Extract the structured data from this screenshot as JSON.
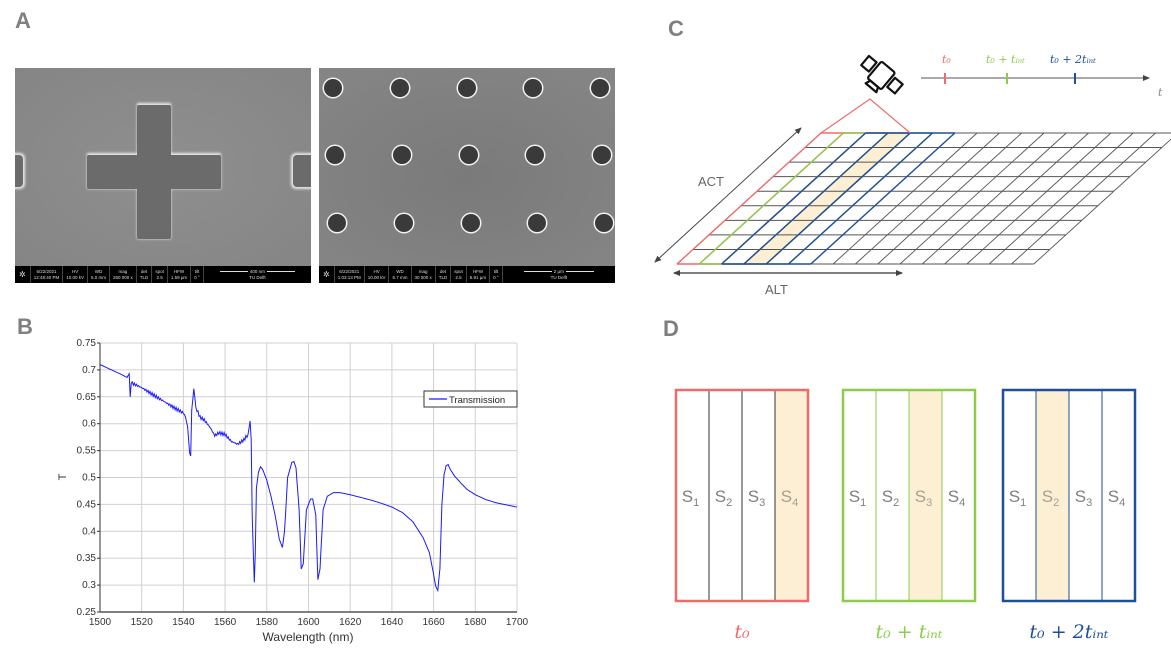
{
  "panels": {
    "a": {
      "label": "A",
      "images": [
        {
          "subject": "cross-shaped-aperture",
          "info_bar": {
            "date": "6/22/2021",
            "time": "12:48:40 PM",
            "hv_label": "HV",
            "hv": "10.00 kV",
            "wd_label": "WD",
            "wd": "5.0 mm",
            "mag_label": "mag",
            "mag": "260 000 x",
            "det_label": "det",
            "det": "TLD",
            "spot_label": "spot",
            "spot": "2.5",
            "hfw_label": "HFW",
            "hfw": "1.59 µm",
            "tilt_label": "tilt",
            "tilt": "0 °",
            "scale": "400 nm",
            "institution": "TU Delft"
          }
        },
        {
          "subject": "circular-hole-array",
          "info_bar": {
            "date": "6/22/2021",
            "time": "1:03:13 PM",
            "hv_label": "HV",
            "hv": "10.00 kV",
            "wd_label": "WD",
            "wd": "6.7 mm",
            "mag_label": "mag",
            "mag": "30 000 x",
            "det_label": "det",
            "det": "TLD",
            "spot_label": "spot",
            "spot": "2.5",
            "hfw_label": "HFW",
            "hfw": "6.91 µm",
            "tilt_label": "tilt",
            "tilt": "0 °",
            "scale": "2 µm",
            "institution": "TU Delft"
          }
        }
      ]
    },
    "b": {
      "label": "B"
    },
    "c": {
      "label": "C",
      "act_label": "ACT",
      "alt_label": "ALT",
      "time_axis_label": "t",
      "time_marks": [
        {
          "label": "t₀",
          "color": "#f06a6a"
        },
        {
          "label": "t₀ + tᵢₙₜ",
          "color": "#8ccc4a"
        },
        {
          "label": "t₀ + 2tᵢₙₜ",
          "color": "#1f4e9c"
        }
      ],
      "satellite_icon": "satellite-icon"
    },
    "d": {
      "label": "D",
      "frames": [
        {
          "caption": "t₀",
          "color": "#f06a6a",
          "highlight_index": 3,
          "strips": [
            {
              "s": "S",
              "sub": "1"
            },
            {
              "s": "S",
              "sub": "2"
            },
            {
              "s": "S",
              "sub": "3"
            },
            {
              "s": "S",
              "sub": "4"
            }
          ]
        },
        {
          "caption": "t₀ + tᵢₙₜ",
          "color": "#8ccc4a",
          "highlight_index": 2,
          "strips": [
            {
              "s": "S",
              "sub": "1"
            },
            {
              "s": "S",
              "sub": "2"
            },
            {
              "s": "S",
              "sub": "3"
            },
            {
              "s": "S",
              "sub": "4"
            }
          ]
        },
        {
          "caption": "t₀ + 2tᵢₙₜ",
          "color": "#1f4e9c",
          "highlight_index": 1,
          "strips": [
            {
              "s": "S",
              "sub": "1"
            },
            {
              "s": "S",
              "sub": "2"
            },
            {
              "s": "S",
              "sub": "3"
            },
            {
              "s": "S",
              "sub": "4"
            }
          ]
        }
      ],
      "highlight_color": "#fdefd4"
    }
  },
  "chart_data": {
    "type": "line",
    "title": "",
    "xlabel": "Wavelength (nm)",
    "ylabel": "T",
    "xlim": [
      1500,
      1700
    ],
    "ylim": [
      0.25,
      0.75
    ],
    "xticks": [
      1500,
      1520,
      1540,
      1560,
      1580,
      1600,
      1620,
      1640,
      1660,
      1680,
      1700
    ],
    "yticks": [
      0.25,
      0.3,
      0.35,
      0.4,
      0.45,
      0.5,
      0.55,
      0.6,
      0.65,
      0.7,
      0.75
    ],
    "ytick_labels": [
      "0.25",
      "0.3",
      "0.35",
      "0.4",
      "0.45",
      "0.5",
      "0.55",
      "0.6",
      "0.65",
      "0.7",
      "0.75"
    ],
    "grid": true,
    "legend_position": "top-right",
    "series": [
      {
        "name": "Transmission",
        "color": "#1a1aff",
        "x": [
          1500,
          1505,
          1510,
          1513,
          1514,
          1514.5,
          1515,
          1520,
          1525,
          1530,
          1535,
          1540,
          1541,
          1542,
          1543,
          1543.5,
          1544,
          1545,
          1546,
          1548,
          1550,
          1553,
          1555,
          1557,
          1560,
          1563,
          1566,
          1569,
          1571,
          1572,
          1572.5,
          1573,
          1574,
          1574.5,
          1575,
          1576,
          1577,
          1578,
          1580,
          1582,
          1584,
          1586,
          1587.5,
          1588.5,
          1590,
          1592,
          1593,
          1594,
          1595.5,
          1596.5,
          1597.5,
          1599,
          1601,
          1602,
          1603.5,
          1604.5,
          1605.5,
          1607,
          1609,
          1612,
          1615,
          1620,
          1625,
          1630,
          1635,
          1640,
          1645,
          1650,
          1655,
          1658,
          1660,
          1661,
          1662,
          1663,
          1664,
          1665,
          1666,
          1667,
          1668,
          1670,
          1673,
          1676,
          1680,
          1685,
          1690,
          1695,
          1700
        ],
        "y": [
          0.71,
          0.701,
          0.692,
          0.686,
          0.693,
          0.65,
          0.676,
          0.667,
          0.655,
          0.643,
          0.631,
          0.62,
          0.612,
          0.595,
          0.545,
          0.54,
          0.625,
          0.665,
          0.63,
          0.612,
          0.607,
          0.592,
          0.578,
          0.583,
          0.58,
          0.567,
          0.562,
          0.57,
          0.58,
          0.605,
          0.57,
          0.43,
          0.305,
          0.36,
          0.48,
          0.51,
          0.52,
          0.515,
          0.495,
          0.465,
          0.43,
          0.385,
          0.37,
          0.4,
          0.5,
          0.528,
          0.53,
          0.518,
          0.44,
          0.33,
          0.34,
          0.44,
          0.46,
          0.46,
          0.43,
          0.31,
          0.33,
          0.44,
          0.465,
          0.472,
          0.472,
          0.468,
          0.463,
          0.458,
          0.452,
          0.445,
          0.435,
          0.418,
          0.388,
          0.36,
          0.32,
          0.298,
          0.29,
          0.33,
          0.45,
          0.505,
          0.522,
          0.524,
          0.515,
          0.503,
          0.49,
          0.478,
          0.468,
          0.459,
          0.453,
          0.449,
          0.445
        ]
      }
    ]
  }
}
